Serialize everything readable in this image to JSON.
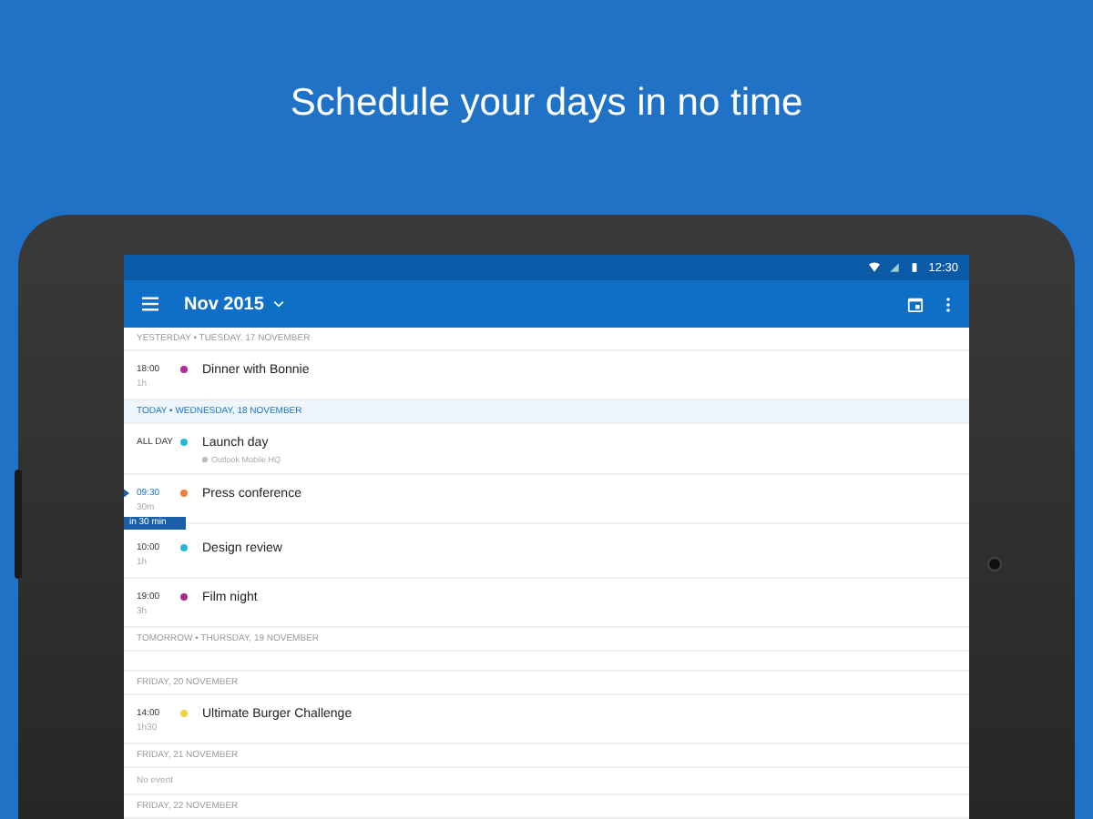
{
  "headline": "Schedule your days in no time",
  "status_bar": {
    "time": "12:30"
  },
  "app_bar": {
    "title": "Nov 2015"
  },
  "days": [
    {
      "header": "YESTERDAY • TUESDAY, 17 NOVEMBER",
      "today": false,
      "events": [
        {
          "time": "18:00",
          "duration": "1h",
          "title": "Dinner with Bonnie",
          "color": "#b5289e",
          "now": false
        }
      ]
    },
    {
      "header": "TODAY • WEDNESDAY, 18 NOVEMBER",
      "today": true,
      "events": [
        {
          "time": "ALL DAY",
          "title": "Launch day",
          "location": "Outlook Mobile HQ",
          "color": "#29b6d6",
          "now": false
        },
        {
          "time": "09:30",
          "duration": "30m",
          "title": "Press conference",
          "color": "#f07f3c",
          "now": true,
          "badge": "in 30 min"
        },
        {
          "time": "10:00",
          "duration": "1h",
          "title": "Design review",
          "color": "#29b6d6",
          "now": false
        },
        {
          "time": "19:00",
          "duration": "3h",
          "title": "Film night",
          "color": "#a03090",
          "now": false
        }
      ]
    },
    {
      "header": "TOMORROW • THURSDAY, 19 NOVEMBER",
      "today": false
    },
    {
      "header": "FRIDAY, 20 NOVEMBER",
      "today": false,
      "events": [
        {
          "time": "14:00",
          "duration": "1h30",
          "title": "Ultimate Burger Challenge",
          "color": "#f5d23c",
          "now": false
        }
      ]
    },
    {
      "header": "FRIDAY, 21 NOVEMBER",
      "today": false,
      "empty_text": "No event"
    },
    {
      "header": "FRIDAY, 22 NOVEMBER",
      "today": false
    }
  ]
}
